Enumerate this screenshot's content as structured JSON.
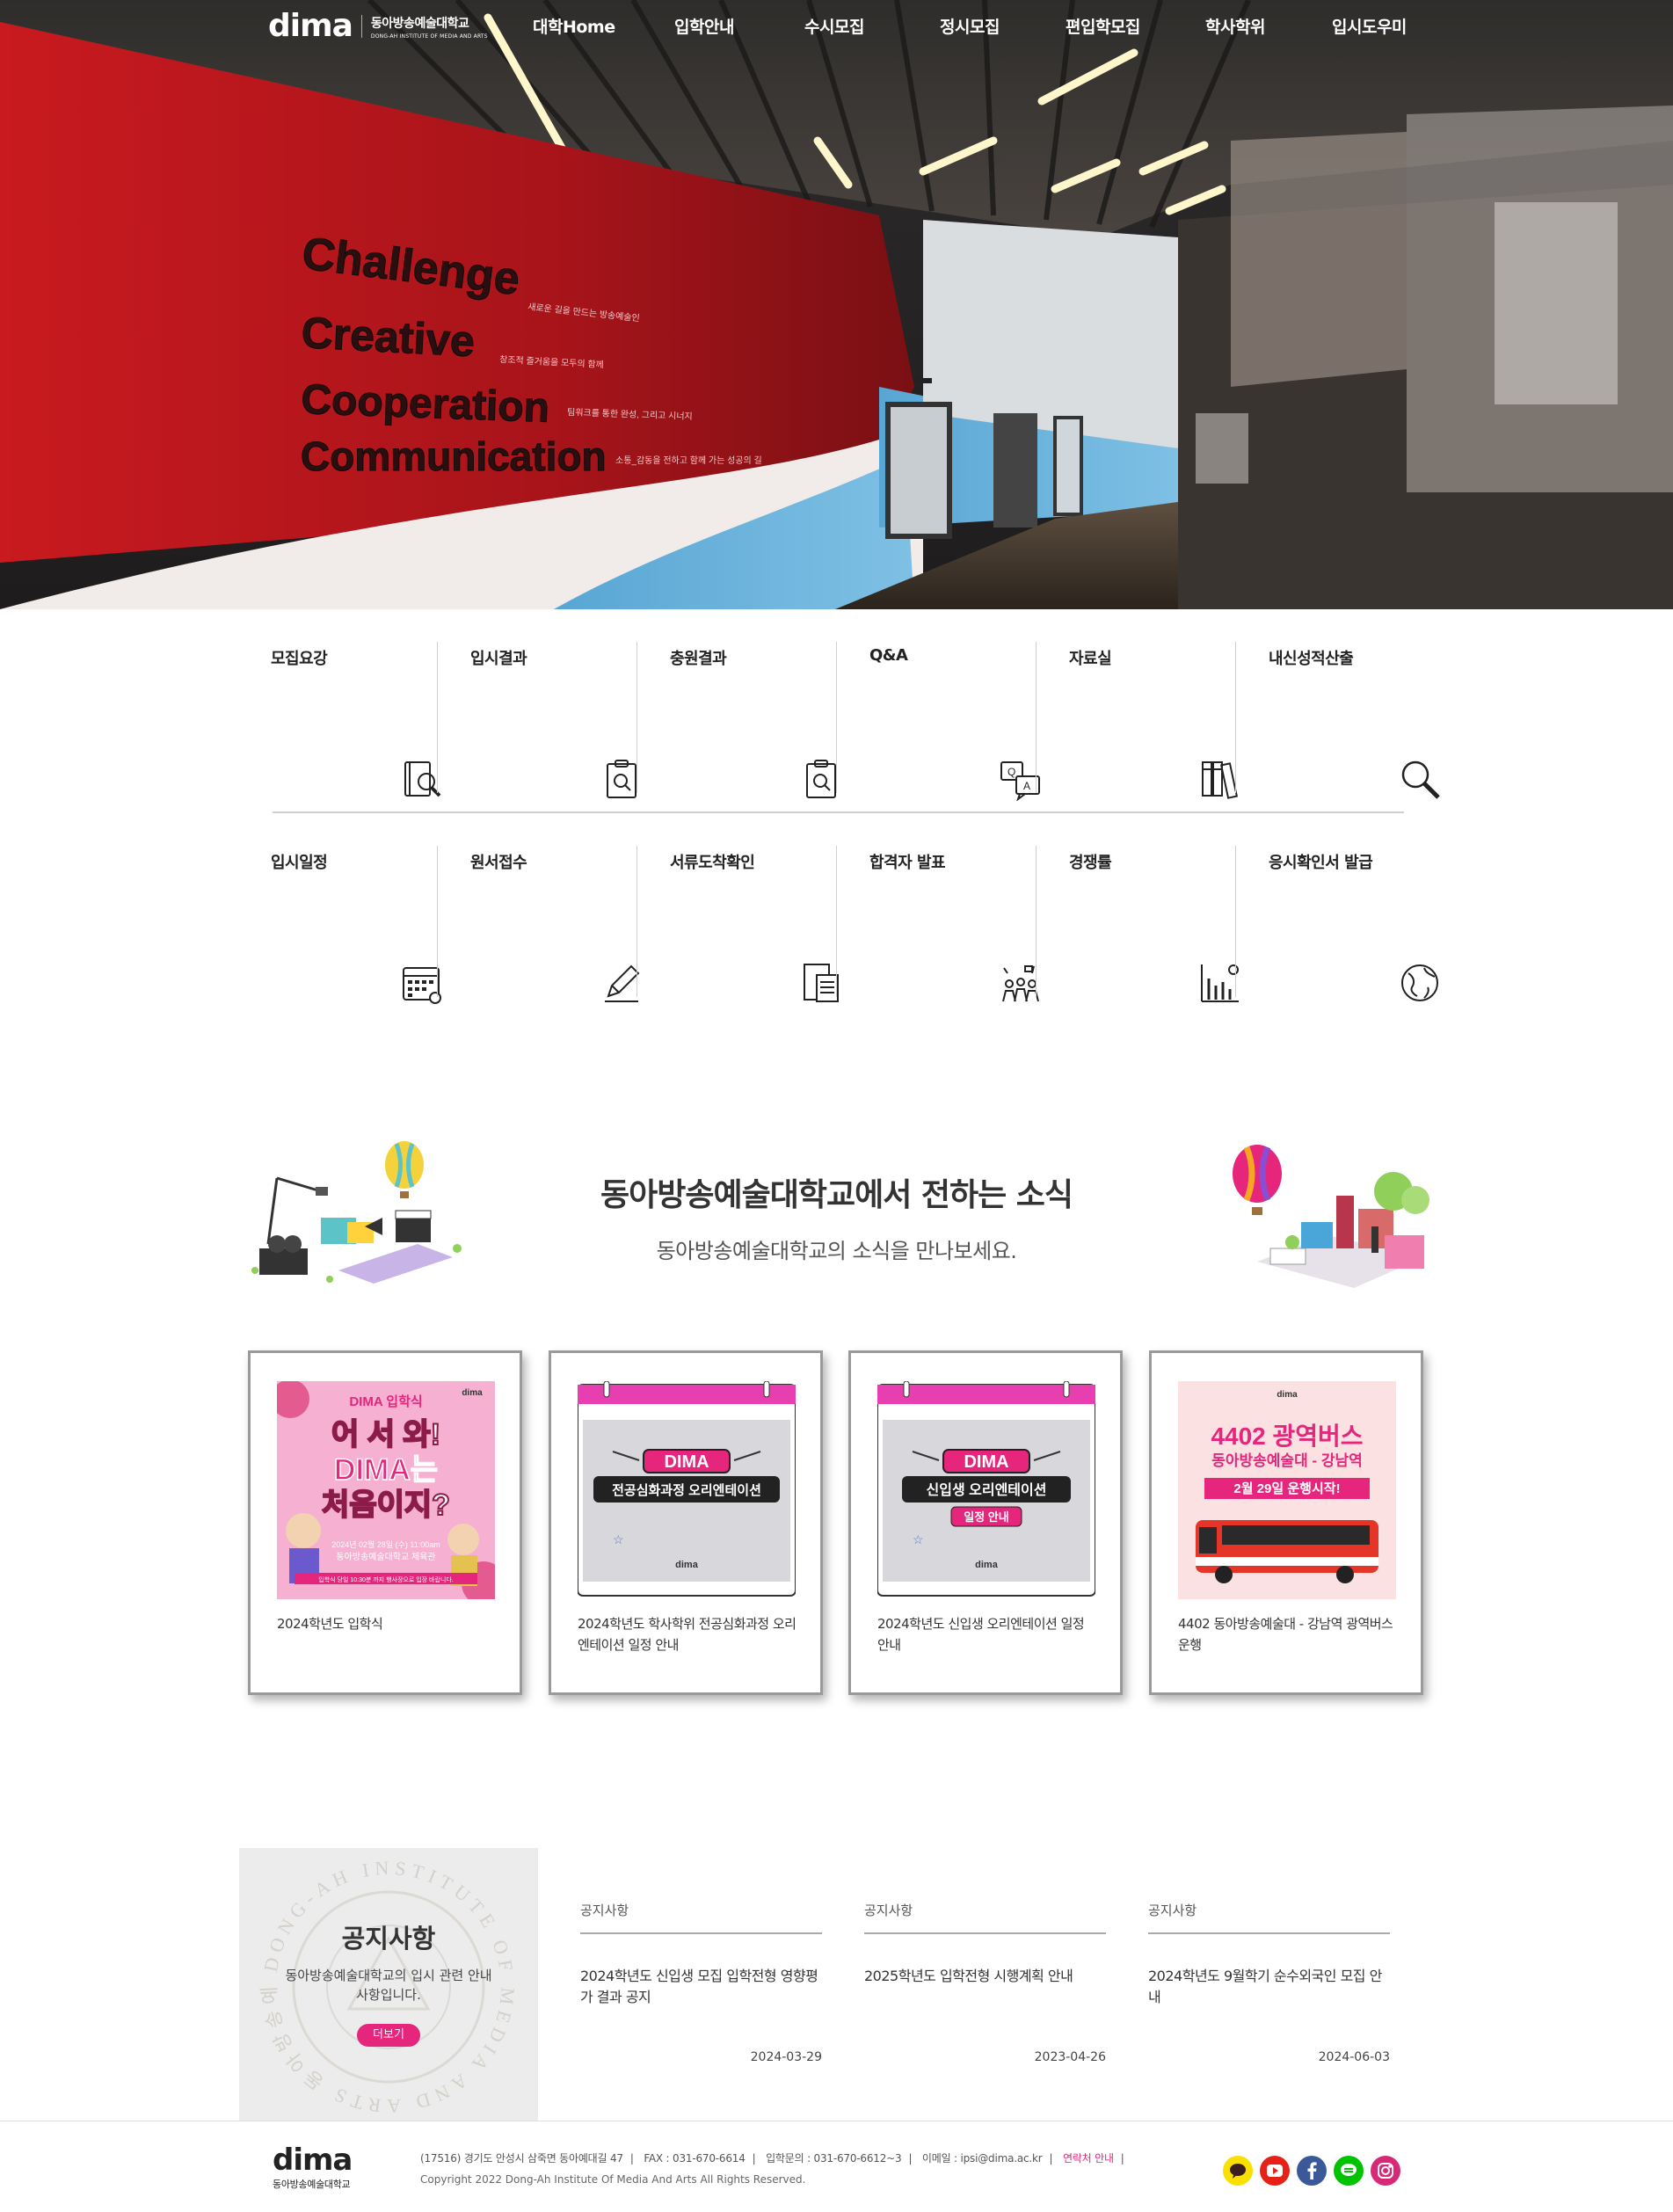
{
  "header": {
    "logo": "dima",
    "logo_ko": "동아방송예술대학교",
    "logo_en": "DONG-AH INSTITUTE OF MEDIA AND ARTS",
    "nav": [
      "대학Home",
      "입학안내",
      "수시모집",
      "정시모집",
      "편입학모집",
      "학사학위",
      "입시도우미"
    ]
  },
  "hero": {
    "words": [
      "Challenge",
      "Creative",
      "Cooperation",
      "Communication"
    ],
    "taglines": [
      "새로운 길을 만드는 방송예술인",
      "창조적 즐거움을 모두의 함께",
      "팀워크를 통한 완성, 그리고 시너지",
      "소통_감동을 전하고 함께 가는 성공의 길"
    ]
  },
  "quick_menu": {
    "row1": [
      {
        "label": "모집요강",
        "icon": "book-search-icon"
      },
      {
        "label": "입시결과",
        "icon": "clipboard-search-icon"
      },
      {
        "label": "충원결과",
        "icon": "clipboard-search-icon"
      },
      {
        "label": "Q&A",
        "icon": "qna-icon"
      },
      {
        "label": "자료실",
        "icon": "binders-icon"
      },
      {
        "label": "내신성적산출",
        "icon": "magnifier-icon"
      }
    ],
    "row2": [
      {
        "label": "입시일정",
        "icon": "calendar-icon"
      },
      {
        "label": "원서접수",
        "icon": "pencil-icon"
      },
      {
        "label": "서류도착확인",
        "icon": "document-icon"
      },
      {
        "label": "합격자 발표",
        "icon": "celebration-icon"
      },
      {
        "label": "경쟁률",
        "icon": "bar-chart-icon"
      },
      {
        "label": "응시확인서 발급",
        "icon": "globe-icon"
      }
    ]
  },
  "news": {
    "title": "동아방송예술대학교에서 전하는 소식",
    "subtitle": "동아방송예술대학교의 소식을 만나보세요.",
    "cards": [
      {
        "caption": "2024학년도 입학식",
        "thumb": {
          "top": "DIMA 입학식",
          "line1": "어 서 와!",
          "line2": "DIMA는",
          "line3": "처음이지?",
          "date": "2024년 02월 28일 (수) 11:00am",
          "place": "동아방송예술대학교 체육관",
          "note": "입학식 당일 10:30분 까지 행사장으로 입장 바랍니다.",
          "logo": "dima"
        }
      },
      {
        "caption": "2024학년도 학사학위 전공심화과정 오리엔테이션 일정 안내",
        "thumb": {
          "badge": "DIMA",
          "banner": "전공심화과정 오리엔테이션",
          "logo": "dima"
        }
      },
      {
        "caption": "2024학년도 신입생 오리엔테이션 일정 안내",
        "thumb": {
          "badge": "DIMA",
          "banner": "신입생 오리엔테이션",
          "sub": "일정 안내",
          "logo": "dima"
        }
      },
      {
        "caption": "4402 동아방송예술대 - 강남역 광역버스 운행",
        "thumb": {
          "logo": "dima",
          "headline": "4402 광역버스",
          "route": "동아방송예술대 - 강남역",
          "start": "2월 29일 운행시작!"
        }
      }
    ]
  },
  "notice": {
    "title": "공지사항",
    "desc": "동아방송예술대학교의 입시 관련 안내사항입니다.",
    "more": "더보기",
    "ring_text": "DONG-AH INSTITUTE OF MEDIA AND ARTS 동아방송예술대학교",
    "items": [
      {
        "cat": "공지사항",
        "title": "2024학년도 신입생 모집 입학전형 영향평가 결과 공지",
        "date": "2024-03-29"
      },
      {
        "cat": "공지사항",
        "title": "2025학년도 입학전형 시행계획 안내",
        "date": "2023-04-26"
      },
      {
        "cat": "공지사항",
        "title": "2024학년도 9월학기 순수외국인 모집 안내",
        "date": "2024-06-03"
      }
    ]
  },
  "footer": {
    "logo": "dima",
    "logo_ko": "동아방송예술대학교",
    "address": "(17516) 경기도 안성시 삼죽면 동아예대길 47",
    "fax": "FAX : 031-670-6614",
    "phone": "입학문의 : 031-670-6612~3",
    "email": "이메일 : ipsi@dima.ac.kr",
    "contact": "연락처 안내",
    "copyright": "Copyright 2022 Dong-Ah Institute Of Media And Arts All Rights Reserved.",
    "sns": [
      {
        "name": "kakaotalk-icon",
        "color": "#f9e000"
      },
      {
        "name": "youtube-icon",
        "color": "#e62117"
      },
      {
        "name": "facebook-icon",
        "color": "#3b5998"
      },
      {
        "name": "line-icon",
        "color": "#00c300"
      },
      {
        "name": "instagram-icon",
        "color": "#d62976"
      }
    ]
  }
}
